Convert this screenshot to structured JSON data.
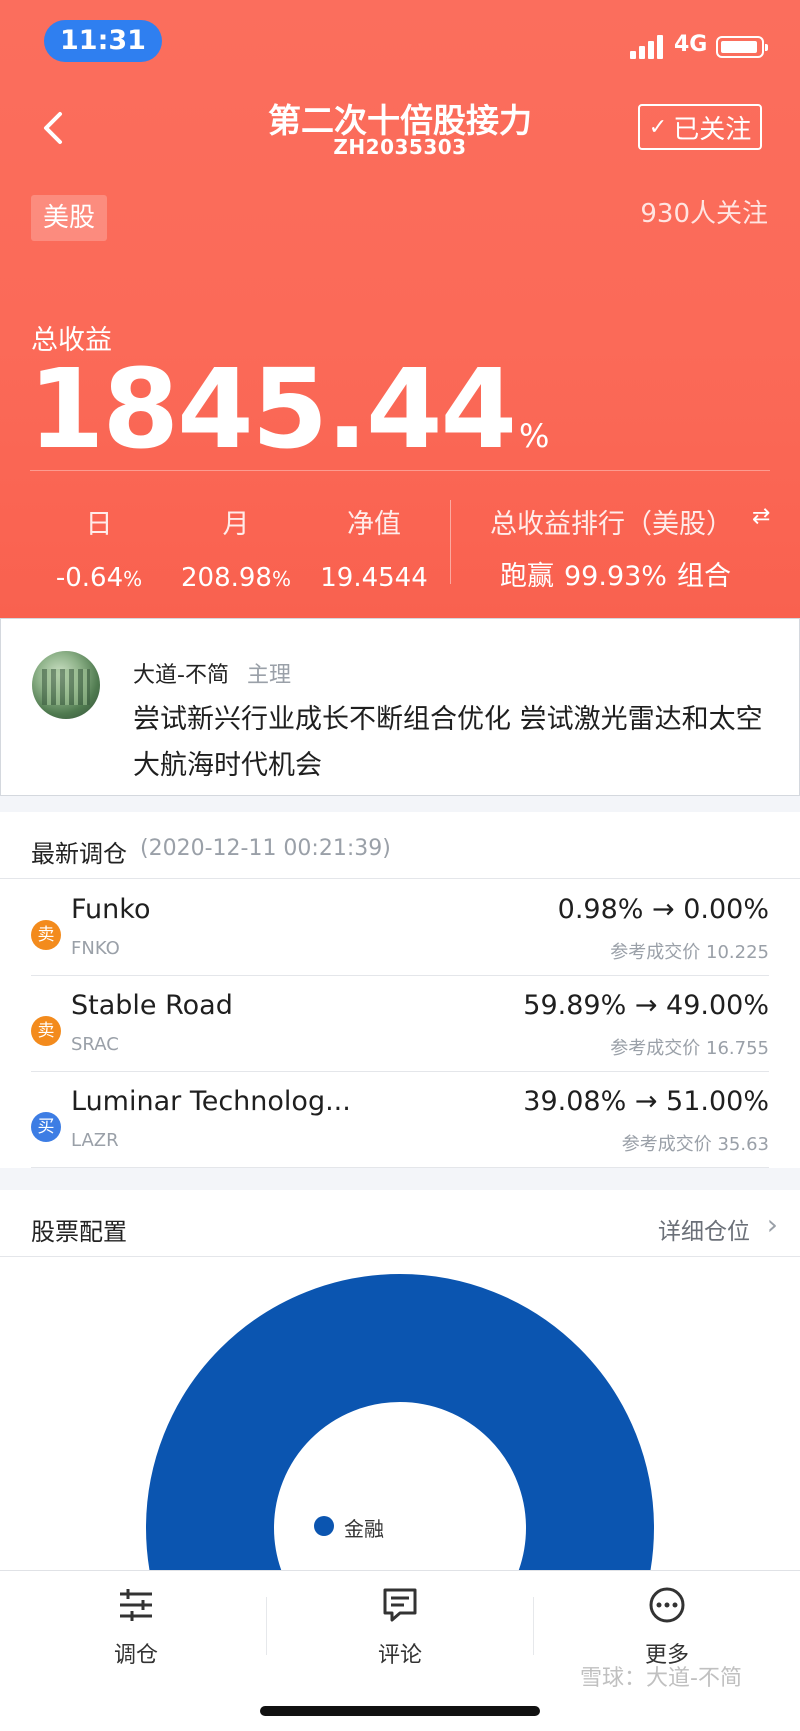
{
  "status_bar": {
    "time": "11:31",
    "network": "4G"
  },
  "header": {
    "title": "第二次十倍股接力",
    "code": "ZH2035303",
    "follow_label": "已关注",
    "market_tag": "美股",
    "followers": "930人关注",
    "total_label": "总收益",
    "total_value": "1845.44",
    "total_unit": "%",
    "stats": [
      {
        "label": "日",
        "value": "-0.64",
        "unit": "%"
      },
      {
        "label": "月",
        "value": "208.98",
        "unit": "%"
      },
      {
        "label": "净值",
        "value": "19.4544",
        "unit": ""
      }
    ],
    "rank_label": "总收益排行（美股）",
    "rank_prefix": "跑赢",
    "rank_value": "99.93%",
    "rank_suffix": "组合"
  },
  "manager": {
    "name": "大道-不简",
    "role": "主理",
    "description": "尝试新兴行业成长不断组合优化  尝试激光雷达和太空大航海时代机会"
  },
  "rebalance": {
    "title": "最新调仓",
    "date": "(2020-12-11 00:21:39)",
    "trades": [
      {
        "action": "卖",
        "type": "sell",
        "name": "Funko",
        "code": "FNKO",
        "change": "0.98% → 0.00%",
        "ref": "参考成交价 10.225"
      },
      {
        "action": "卖",
        "type": "sell",
        "name": "Stable Road",
        "code": "SRAC",
        "change": "59.89% → 49.00%",
        "ref": "参考成交价 16.755"
      },
      {
        "action": "买",
        "type": "buy",
        "name": "Luminar Technolog...",
        "code": "LAZR",
        "change": "39.08% → 51.00%",
        "ref": "参考成交价 35.63"
      }
    ]
  },
  "allocation": {
    "title": "股票配置",
    "detail_link": "详细仓位",
    "legend": "金融",
    "color": "#0b55b0"
  },
  "tabbar": {
    "items": [
      {
        "label": "调仓",
        "icon": "sliders-icon"
      },
      {
        "label": "评论",
        "icon": "comment-icon"
      },
      {
        "label": "更多",
        "icon": "more-icon"
      }
    ]
  },
  "watermark": "雪球：大道-不简"
}
